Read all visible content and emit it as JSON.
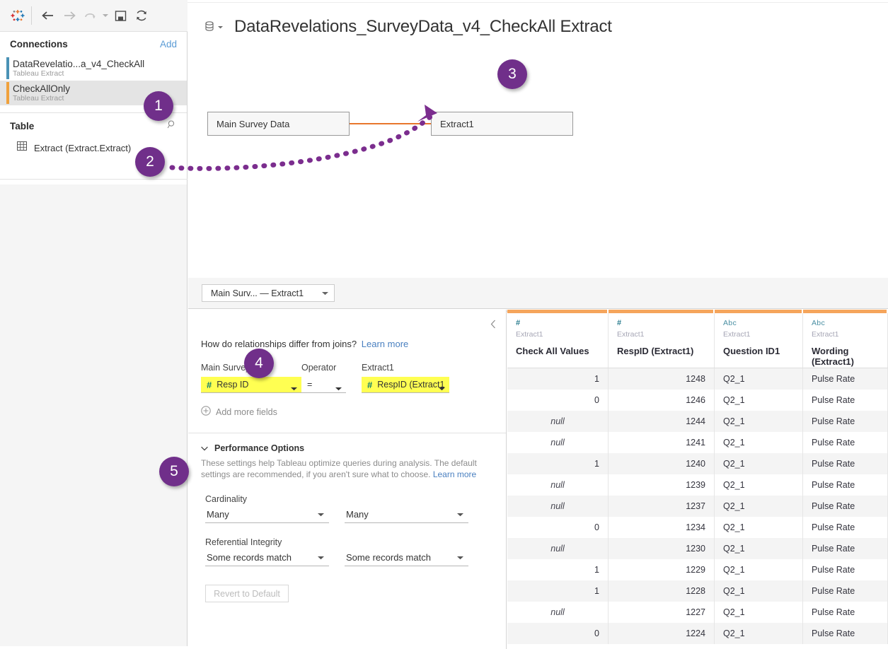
{
  "toolbar": {
    "logo_icon": "tableau-logo-icon",
    "back_icon": "back-arrow-icon",
    "forward_icon": "forward-arrow-icon",
    "undo_icon": "undo-arrow-icon",
    "undo_caret_icon": "chevron-down-icon",
    "save_icon": "save-icon",
    "refresh_icon": "refresh-icon"
  },
  "sidebar": {
    "connections_title": "Connections",
    "add_label": "Add",
    "connections": [
      {
        "name": "DataRevelatio...a_v4_CheckAll",
        "type": "Tableau Extract",
        "bar_color": "#4a92b5",
        "selected": false
      },
      {
        "name": "CheckAllOnly",
        "type": "Tableau Extract",
        "bar_color": "#f0a13c",
        "selected": true
      }
    ],
    "table_title": "Table",
    "search_icon": "search-icon",
    "table_items": [
      {
        "icon": "table-grid-icon",
        "label": "Extract (Extract.Extract)"
      }
    ]
  },
  "header": {
    "db_icon": "database-icon",
    "db_caret_icon": "chevron-down-icon",
    "title": "DataRevelations_SurveyData_v4_CheckAll Extract"
  },
  "canvas": {
    "tables": [
      {
        "name": "Main Survey Data"
      },
      {
        "name": "Extract1"
      }
    ],
    "relationship_line_color": "#e8762d"
  },
  "tab_strip": {
    "relationship_tab_label": "Main Surv...  —  Extract1",
    "tab_caret_icon": "chevron-down-icon"
  },
  "rel_editor": {
    "collapse_icon": "chevron-left-icon",
    "help_text": "How do relationships differ from joins?",
    "help_link": "Learn more",
    "left_table_label": "Main Survey Data",
    "operator_label": "Operator",
    "right_table_label": "Extract1",
    "left_field": {
      "icon": "number-field-icon",
      "value": "Resp ID",
      "highlight_color": "#ffff52"
    },
    "operator_value": "=",
    "right_field": {
      "icon": "number-field-icon",
      "value": "RespID (Extract1",
      "highlight_color": "#ffff52"
    },
    "add_more_fields_label": "Add more fields",
    "add_more_fields_icon": "plus-circle-icon",
    "performance": {
      "chevron_icon": "chevron-down-icon",
      "title": "Performance Options",
      "description": "These settings help Tableau optimize queries during analysis. The default settings are recommended, if you aren't sure what to choose.",
      "description_link": "Learn more",
      "cardinality_label": "Cardinality",
      "cardinality_left": "Many",
      "cardinality_right": "Many",
      "referential_label": "Referential Integrity",
      "referential_left": "Some records match",
      "referential_right": "Some records match",
      "revert_label": "Revert to Default",
      "caret_icon": "chevron-down-icon"
    }
  },
  "grid": {
    "accent_color": "#f5a55c",
    "columns": [
      {
        "type_icon": "#",
        "type_kind": "number",
        "source": "Extract1",
        "name": "Check All Values",
        "align": "right"
      },
      {
        "type_icon": "#",
        "type_kind": "number",
        "source": "Extract1",
        "name": "RespID (Extract1)",
        "align": "right"
      },
      {
        "type_icon": "Abc",
        "type_kind": "string",
        "source": "Extract1",
        "name": "Question ID1",
        "align": "left"
      },
      {
        "type_icon": "Abc",
        "type_kind": "string",
        "source": "Extract1",
        "name": "Wording (Extract1)",
        "align": "left"
      }
    ],
    "rows": [
      [
        "1",
        "1248",
        "Q2_1",
        "Pulse Rate"
      ],
      [
        "0",
        "1246",
        "Q2_1",
        "Pulse Rate"
      ],
      [
        "null",
        "1244",
        "Q2_1",
        "Pulse Rate"
      ],
      [
        "null",
        "1241",
        "Q2_1",
        "Pulse Rate"
      ],
      [
        "1",
        "1240",
        "Q2_1",
        "Pulse Rate"
      ],
      [
        "null",
        "1239",
        "Q2_1",
        "Pulse Rate"
      ],
      [
        "null",
        "1237",
        "Q2_1",
        "Pulse Rate"
      ],
      [
        "0",
        "1234",
        "Q2_1",
        "Pulse Rate"
      ],
      [
        "null",
        "1230",
        "Q2_1",
        "Pulse Rate"
      ],
      [
        "1",
        "1229",
        "Q2_1",
        "Pulse Rate"
      ],
      [
        "1",
        "1228",
        "Q2_1",
        "Pulse Rate"
      ],
      [
        "null",
        "1227",
        "Q2_1",
        "Pulse Rate"
      ],
      [
        "0",
        "1224",
        "Q2_1",
        "Pulse Rate"
      ]
    ]
  },
  "annotations": {
    "badge_color": "#702f8a",
    "arrow_color": "#7b2d8e",
    "badges": [
      {
        "id": "1",
        "label": "1"
      },
      {
        "id": "2",
        "label": "2"
      },
      {
        "id": "3",
        "label": "3"
      },
      {
        "id": "4",
        "label": "4"
      },
      {
        "id": "5",
        "label": "5"
      }
    ]
  }
}
